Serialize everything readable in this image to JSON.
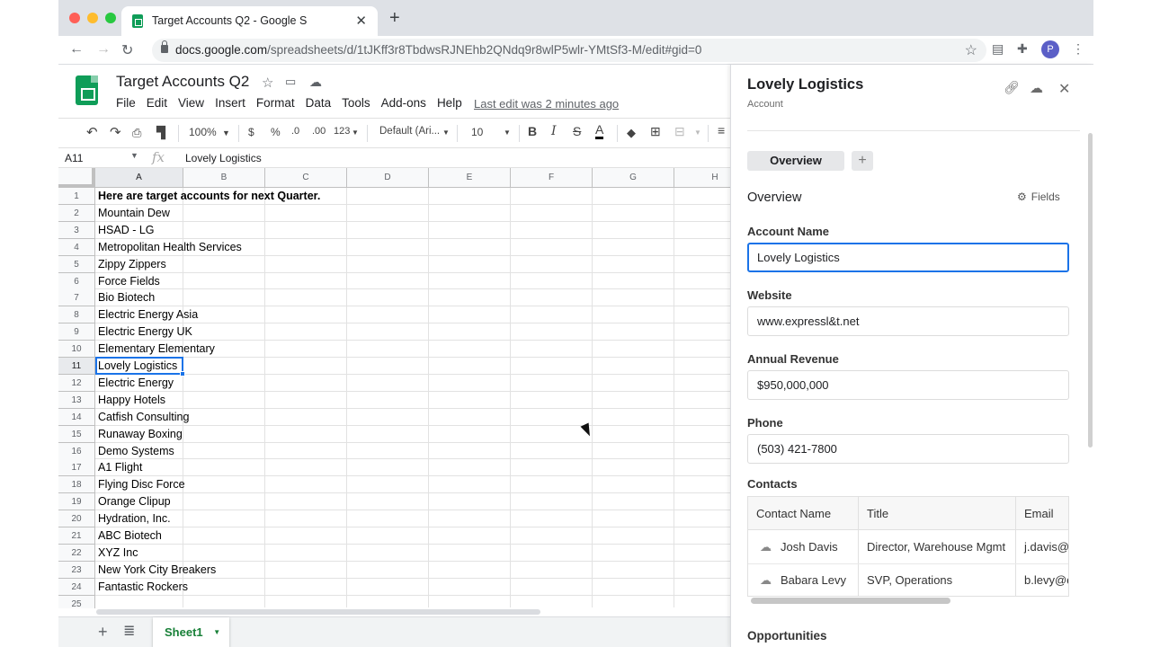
{
  "browser": {
    "tab_title": "Target Accounts Q2 - Google S",
    "url_host": "docs.google.com",
    "url_path": "/spreadsheets/d/1tJKff3r8TbdwsRJNEhb2QNdq9r8wlP5wlr-YMtSf3-M/edit#gid=0",
    "profile_initial": "P"
  },
  "sheets": {
    "doc_title": "Target Accounts Q2",
    "menus": [
      "File",
      "Edit",
      "View",
      "Insert",
      "Format",
      "Data",
      "Tools",
      "Add-ons",
      "Help"
    ],
    "last_edit": "Last edit was 2 minutes ago",
    "toolbar": {
      "zoom": "100%",
      "currency": "$",
      "percent": "%",
      "dec_less": ".0",
      "dec_more": ".00",
      "more_formats": "123",
      "font": "Default (Ari...",
      "font_size": "10",
      "bold": "B",
      "italic": "I",
      "strike": "S",
      "text_color": "A"
    },
    "name_box": "A11",
    "formula_value": "Lovely Logistics",
    "columns": [
      "A",
      "B",
      "C",
      "D",
      "E",
      "F",
      "G",
      "H"
    ],
    "rows": [
      {
        "n": "1",
        "a": "Here are target accounts for next Quarter.",
        "bold": true
      },
      {
        "n": "2",
        "a": "Mountain Dew"
      },
      {
        "n": "3",
        "a": "HSAD - LG"
      },
      {
        "n": "4",
        "a": "Metropolitan Health Services"
      },
      {
        "n": "5",
        "a": "Zippy Zippers"
      },
      {
        "n": "6",
        "a": "Force Fields"
      },
      {
        "n": "7",
        "a": "Bio Biotech"
      },
      {
        "n": "8",
        "a": "Electric Energy Asia"
      },
      {
        "n": "9",
        "a": "Electric Energy UK"
      },
      {
        "n": "10",
        "a": "Elementary Elementary"
      },
      {
        "n": "11",
        "a": "Lovely Logistics",
        "selected": true
      },
      {
        "n": "12",
        "a": "Electric Energy"
      },
      {
        "n": "13",
        "a": "Happy Hotels"
      },
      {
        "n": "14",
        "a": "Catfish Consulting"
      },
      {
        "n": "15",
        "a": "Runaway Boxing"
      },
      {
        "n": "16",
        "a": "Demo Systems"
      },
      {
        "n": "17",
        "a": "A1 Flight"
      },
      {
        "n": "18",
        "a": "Flying Disc Force"
      },
      {
        "n": "19",
        "a": "Orange Clipup"
      },
      {
        "n": "20",
        "a": "Hydration, Inc."
      },
      {
        "n": "21",
        "a": "ABC Biotech"
      },
      {
        "n": "22",
        "a": "XYZ Inc"
      },
      {
        "n": "23",
        "a": "New York City Breakers"
      },
      {
        "n": "24",
        "a": "Fantastic Rockers"
      },
      {
        "n": "25",
        "a": ""
      }
    ],
    "sheet_tab": "Sheet1"
  },
  "panel": {
    "title": "Lovely Logistics",
    "subtitle": "Account",
    "tab_overview": "Overview",
    "tab_add": "+",
    "section_heading": "Overview",
    "fields_button": "Fields",
    "account_name_label": "Account Name",
    "account_name_value": "Lovely Logistics",
    "website_label": "Website",
    "website_value": "www.expressl&t.net",
    "revenue_label": "Annual Revenue",
    "revenue_value": "$950,000,000",
    "phone_label": "Phone",
    "phone_value": "(503) 421-7800",
    "contacts_label": "Contacts",
    "contacts_headers": [
      "Contact Name",
      "Title",
      "Email"
    ],
    "contacts": [
      {
        "name": "Josh Davis",
        "title": "Director, Warehouse Mgmt",
        "email": "j.davis@e"
      },
      {
        "name": "Babara Levy",
        "title": "SVP, Operations",
        "email": "b.levy@e"
      }
    ],
    "opportunities_label": "Opportunities"
  },
  "colors": {
    "accent": "#1a73e8",
    "sheets_green": "#0f9d58",
    "sheet_tab_text": "#188038"
  }
}
